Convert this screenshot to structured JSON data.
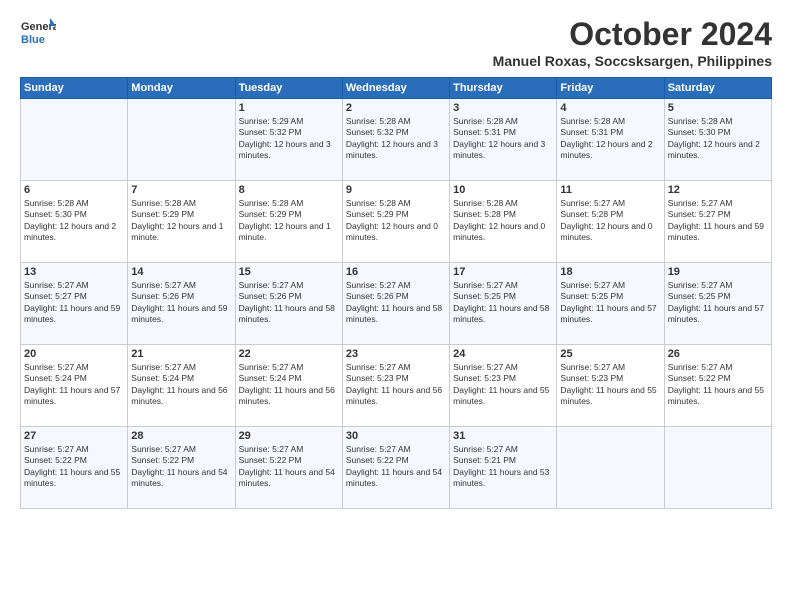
{
  "logo": {
    "line1": "General",
    "line2": "Blue"
  },
  "title": "October 2024",
  "subtitle": "Manuel Roxas, Soccsksargen, Philippines",
  "headers": [
    "Sunday",
    "Monday",
    "Tuesday",
    "Wednesday",
    "Thursday",
    "Friday",
    "Saturday"
  ],
  "weeks": [
    [
      {
        "day": "",
        "info": ""
      },
      {
        "day": "",
        "info": ""
      },
      {
        "day": "1",
        "info": "Sunrise: 5:29 AM\nSunset: 5:32 PM\nDaylight: 12 hours and 3 minutes."
      },
      {
        "day": "2",
        "info": "Sunrise: 5:28 AM\nSunset: 5:32 PM\nDaylight: 12 hours and 3 minutes."
      },
      {
        "day": "3",
        "info": "Sunrise: 5:28 AM\nSunset: 5:31 PM\nDaylight: 12 hours and 3 minutes."
      },
      {
        "day": "4",
        "info": "Sunrise: 5:28 AM\nSunset: 5:31 PM\nDaylight: 12 hours and 2 minutes."
      },
      {
        "day": "5",
        "info": "Sunrise: 5:28 AM\nSunset: 5:30 PM\nDaylight: 12 hours and 2 minutes."
      }
    ],
    [
      {
        "day": "6",
        "info": "Sunrise: 5:28 AM\nSunset: 5:30 PM\nDaylight: 12 hours and 2 minutes."
      },
      {
        "day": "7",
        "info": "Sunrise: 5:28 AM\nSunset: 5:29 PM\nDaylight: 12 hours and 1 minute."
      },
      {
        "day": "8",
        "info": "Sunrise: 5:28 AM\nSunset: 5:29 PM\nDaylight: 12 hours and 1 minute."
      },
      {
        "day": "9",
        "info": "Sunrise: 5:28 AM\nSunset: 5:29 PM\nDaylight: 12 hours and 0 minutes."
      },
      {
        "day": "10",
        "info": "Sunrise: 5:28 AM\nSunset: 5:28 PM\nDaylight: 12 hours and 0 minutes."
      },
      {
        "day": "11",
        "info": "Sunrise: 5:27 AM\nSunset: 5:28 PM\nDaylight: 12 hours and 0 minutes."
      },
      {
        "day": "12",
        "info": "Sunrise: 5:27 AM\nSunset: 5:27 PM\nDaylight: 11 hours and 59 minutes."
      }
    ],
    [
      {
        "day": "13",
        "info": "Sunrise: 5:27 AM\nSunset: 5:27 PM\nDaylight: 11 hours and 59 minutes."
      },
      {
        "day": "14",
        "info": "Sunrise: 5:27 AM\nSunset: 5:26 PM\nDaylight: 11 hours and 59 minutes."
      },
      {
        "day": "15",
        "info": "Sunrise: 5:27 AM\nSunset: 5:26 PM\nDaylight: 11 hours and 58 minutes."
      },
      {
        "day": "16",
        "info": "Sunrise: 5:27 AM\nSunset: 5:26 PM\nDaylight: 11 hours and 58 minutes."
      },
      {
        "day": "17",
        "info": "Sunrise: 5:27 AM\nSunset: 5:25 PM\nDaylight: 11 hours and 58 minutes."
      },
      {
        "day": "18",
        "info": "Sunrise: 5:27 AM\nSunset: 5:25 PM\nDaylight: 11 hours and 57 minutes."
      },
      {
        "day": "19",
        "info": "Sunrise: 5:27 AM\nSunset: 5:25 PM\nDaylight: 11 hours and 57 minutes."
      }
    ],
    [
      {
        "day": "20",
        "info": "Sunrise: 5:27 AM\nSunset: 5:24 PM\nDaylight: 11 hours and 57 minutes."
      },
      {
        "day": "21",
        "info": "Sunrise: 5:27 AM\nSunset: 5:24 PM\nDaylight: 11 hours and 56 minutes."
      },
      {
        "day": "22",
        "info": "Sunrise: 5:27 AM\nSunset: 5:24 PM\nDaylight: 11 hours and 56 minutes."
      },
      {
        "day": "23",
        "info": "Sunrise: 5:27 AM\nSunset: 5:23 PM\nDaylight: 11 hours and 56 minutes."
      },
      {
        "day": "24",
        "info": "Sunrise: 5:27 AM\nSunset: 5:23 PM\nDaylight: 11 hours and 55 minutes."
      },
      {
        "day": "25",
        "info": "Sunrise: 5:27 AM\nSunset: 5:23 PM\nDaylight: 11 hours and 55 minutes."
      },
      {
        "day": "26",
        "info": "Sunrise: 5:27 AM\nSunset: 5:22 PM\nDaylight: 11 hours and 55 minutes."
      }
    ],
    [
      {
        "day": "27",
        "info": "Sunrise: 5:27 AM\nSunset: 5:22 PM\nDaylight: 11 hours and 55 minutes."
      },
      {
        "day": "28",
        "info": "Sunrise: 5:27 AM\nSunset: 5:22 PM\nDaylight: 11 hours and 54 minutes."
      },
      {
        "day": "29",
        "info": "Sunrise: 5:27 AM\nSunset: 5:22 PM\nDaylight: 11 hours and 54 minutes."
      },
      {
        "day": "30",
        "info": "Sunrise: 5:27 AM\nSunset: 5:22 PM\nDaylight: 11 hours and 54 minutes."
      },
      {
        "day": "31",
        "info": "Sunrise: 5:27 AM\nSunset: 5:21 PM\nDaylight: 11 hours and 53 minutes."
      },
      {
        "day": "",
        "info": ""
      },
      {
        "day": "",
        "info": ""
      }
    ]
  ]
}
